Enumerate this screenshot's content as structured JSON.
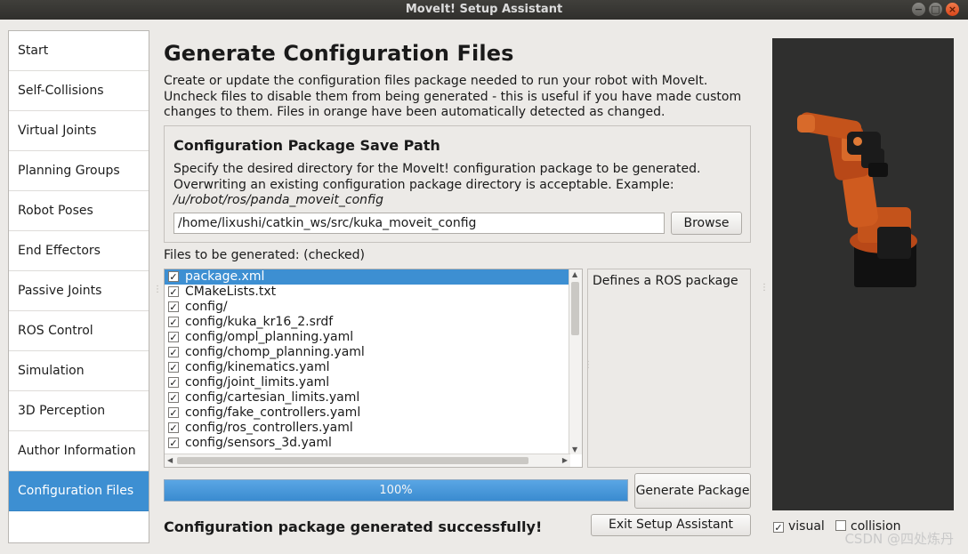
{
  "window": {
    "title": "MoveIt! Setup Assistant"
  },
  "sidebar": {
    "items": [
      {
        "label": "Start"
      },
      {
        "label": "Self-Collisions"
      },
      {
        "label": "Virtual Joints"
      },
      {
        "label": "Planning Groups"
      },
      {
        "label": "Robot Poses"
      },
      {
        "label": "End Effectors"
      },
      {
        "label": "Passive Joints"
      },
      {
        "label": "ROS Control"
      },
      {
        "label": "Simulation"
      },
      {
        "label": "3D Perception"
      },
      {
        "label": "Author Information"
      },
      {
        "label": "Configuration Files",
        "active": true
      }
    ]
  },
  "main": {
    "title": "Generate Configuration Files",
    "description": "Create or update the configuration files package needed to run your robot with MoveIt. Uncheck files to disable them from being generated - this is useful if you have made custom changes to them. Files in orange have been automatically detected as changed."
  },
  "save_path": {
    "title": "Configuration Package Save Path",
    "desc_plain": "Specify the desired directory for the MoveIt! configuration package to be generated. Overwriting an existing configuration package directory is acceptable. Example: ",
    "desc_example": "/u/robot/ros/panda_moveit_config",
    "path_value": "/home/lixushi/catkin_ws/src/kuka_moveit_config",
    "browse_label": "Browse"
  },
  "files": {
    "label": "Files to be generated: (checked)",
    "items": [
      "package.xml",
      "CMakeLists.txt",
      "config/",
      "config/kuka_kr16_2.srdf",
      "config/ompl_planning.yaml",
      "config/chomp_planning.yaml",
      "config/kinematics.yaml",
      "config/joint_limits.yaml",
      "config/cartesian_limits.yaml",
      "config/fake_controllers.yaml",
      "config/ros_controllers.yaml",
      "config/sensors_3d.yaml"
    ],
    "check_glyph": "✓",
    "selected_description": "Defines a ROS package"
  },
  "progress": {
    "value_percent": 100,
    "text": "100%"
  },
  "buttons": {
    "generate": "Generate Package",
    "exit": "Exit Setup Assistant"
  },
  "status": "Configuration package generated successfully!",
  "viewer": {
    "visual_label": "visual",
    "collision_label": "collision",
    "visual_checked": true,
    "collision_checked": false
  },
  "watermark": "CSDN @四处炼丹",
  "colors": {
    "accent": "#3d8fd2",
    "robot_orange": "#c4531b",
    "viewport_bg": "#2f2f2e"
  }
}
